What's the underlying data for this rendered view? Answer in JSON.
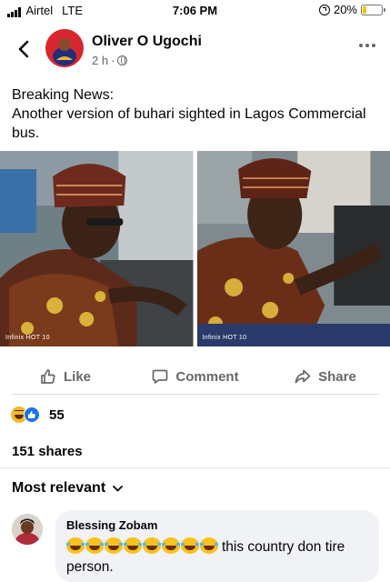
{
  "status_bar": {
    "carrier": "Airtel",
    "network": "LTE",
    "time": "7:06 PM",
    "battery": "20%",
    "battery_level": 0.2
  },
  "post": {
    "author": "Oliver O Ugochi",
    "time_ago": "2 h",
    "separator": "·",
    "privacy_icon": "globe-icon",
    "text_line1": "Breaking News:",
    "text_line2": "Another version of buhari sighted in Lagos Commercial bus.",
    "photo_watermarks": [
      "Infinix HOT 10",
      "Infinix HOT 10"
    ]
  },
  "actions": {
    "like": "Like",
    "comment": "Comment",
    "share": "Share"
  },
  "stats": {
    "reactions_count": "55",
    "shares": "151 shares"
  },
  "comments_section": {
    "sort_label": "Most relevant",
    "comments": [
      {
        "name": "Blessing Zobam",
        "emoji_count": 8,
        "text": "this country don tire person."
      }
    ]
  },
  "colors": {
    "accent": "#1b74e4",
    "secondary_text": "#65676b",
    "bubble_bg": "#f0f2f5",
    "battery_fill": "#f5c400"
  }
}
